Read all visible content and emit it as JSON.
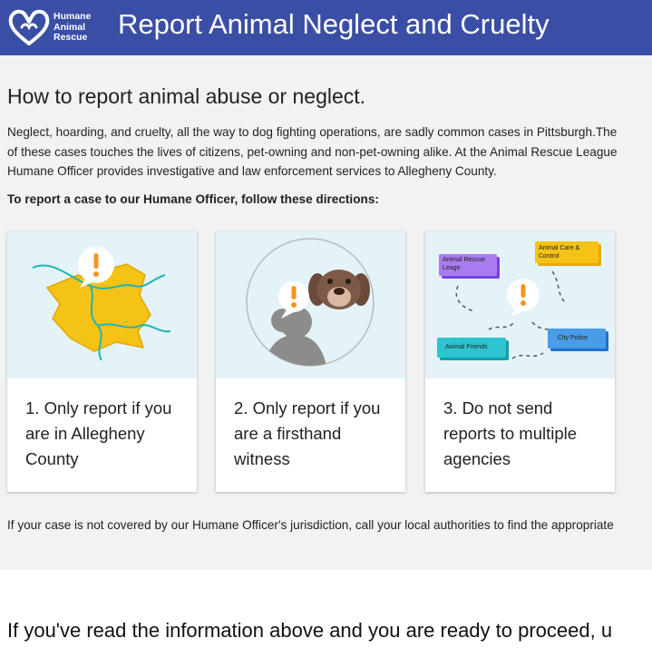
{
  "header": {
    "logo_lines": [
      "Humane",
      "Animal",
      "Rescue"
    ],
    "title": "Report Animal Neglect and Cruelty",
    "background": "#3a4ea5"
  },
  "main": {
    "heading": "How to report animal abuse or neglect.",
    "intro_lines": [
      "Neglect, hoarding, and cruelty, all the way to dog fighting operations, are sadly common cases in Pittsburgh.The",
      "of these cases touches the lives of citizens, pet-owning and non-pet-owning alike. At the Animal Rescue League",
      "Humane Officer provides investigative and law enforcement services to Allegheny County."
    ],
    "directions_label": "To report a case to our Humane Officer, follow these directions:",
    "cards": [
      {
        "icon": "allegheny-map-icon",
        "caption_lines": [
          "1. Only report if you",
          "are in Allegheny",
          "County"
        ]
      },
      {
        "icon": "witness-icon",
        "caption_lines": [
          "2. Only report if you",
          "are a firsthand",
          "witness"
        ]
      },
      {
        "icon": "agencies-icon",
        "caption_lines": [
          "3. Do not send",
          "reports to multiple",
          "agencies"
        ],
        "agency_tags": [
          "Animal Rescue Leage",
          "Animal Care & Control",
          "City Police",
          "Animal Friends"
        ]
      }
    ],
    "footer_note": "If your case is not covered by our Humane Officer's jurisdiction, call your local authorities to find the appropriate",
    "proceed_text": "If you've read the information above and you are ready to proceed, u"
  }
}
